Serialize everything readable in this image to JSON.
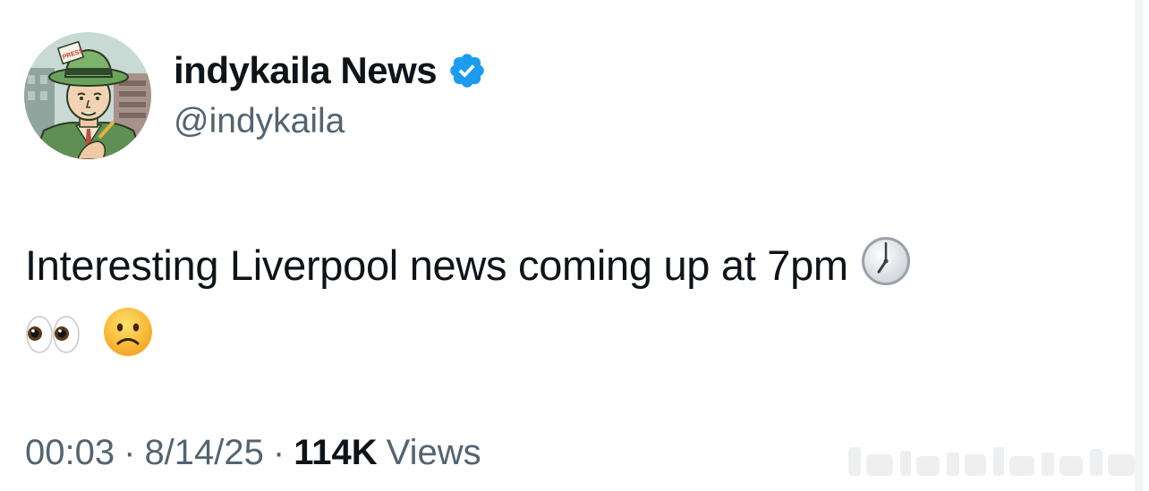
{
  "author": {
    "display_name": "indykaila News",
    "handle": "@indykaila",
    "verified": true,
    "verified_color": "#1d9bf0",
    "avatar_icon": "press-reporter-avatar"
  },
  "tweet": {
    "text": "Interesting Liverpool news coming up at 7pm",
    "emojis": [
      "clock-seven-emoji",
      "eyes-emoji",
      "slightly-frowning-face-emoji"
    ]
  },
  "meta": {
    "time": "00:03",
    "date": "8/14/25",
    "separator": "·",
    "views_count": "114K",
    "views_label": "Views"
  },
  "colors": {
    "text_primary": "#0f1419",
    "text_secondary": "#536471"
  }
}
